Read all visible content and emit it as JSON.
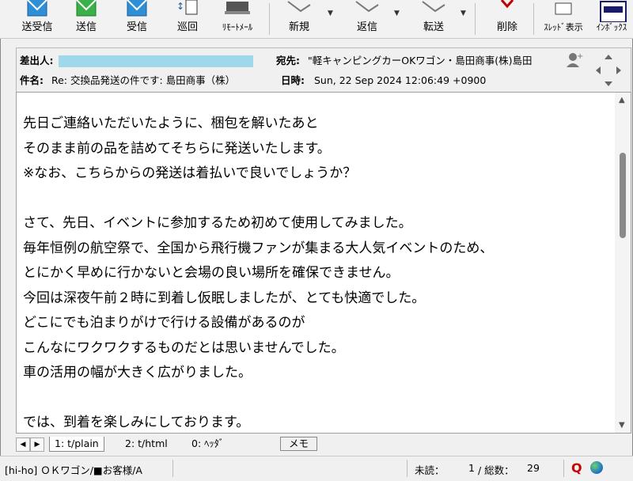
{
  "toolbar": {
    "buttons": [
      {
        "label": "送受信"
      },
      {
        "label": "送信"
      },
      {
        "label": "受信"
      },
      {
        "label": "巡回"
      },
      {
        "label": "ﾘﾓｰﾄﾒｰﾙ"
      },
      {
        "label": "新規"
      },
      {
        "label": "返信"
      },
      {
        "label": "転送"
      },
      {
        "label": "削除"
      },
      {
        "label": "ｽﾚｯﾄﾞ表示"
      },
      {
        "label": "ｲﾝﾎﾞｯｸｽ"
      }
    ]
  },
  "header": {
    "from_label": "差出人:",
    "from_value": "",
    "to_label": "宛先:",
    "to_value": "\"軽キャンピングカーOKワゴン・島田商事(株)島田",
    "subject_label": "件名:",
    "subject_value": "Re: 交換品発送の件です: 島田商事（株）",
    "date_label": "日時:",
    "date_value": "Sun, 22 Sep 2024 12:06:49 +0900"
  },
  "message": {
    "lines": [
      "先日ご連絡いただいたように、梱包を解いたあと",
      "そのまま前の品を詰めてそちらに発送いたします。",
      "※なお、こちらからの発送は着払いで良いでしょうか？",
      "",
      "さて、先日、イベントに参加するため初めて使用してみました。",
      "毎年恒例の航空祭で、全国から飛行機ファンが集まる大人気イベントのため、",
      "とにかく早めに行かないと会場の良い場所を確保できません。",
      "今回は深夜午前２時に到着し仮眠しましたが、とても快適でした。",
      "どこにでも泊まりがけで行ける設備があるのが",
      "こんなにワクワクするものだとは思いませんでした。",
      "車の活用の幅が大きく広がりました。",
      "",
      "では、到着を楽しみにしております。"
    ]
  },
  "tabs": {
    "items": [
      "1: t/plain",
      "2: t/html",
      "0: ﾍｯﾀﾞ"
    ],
    "memo": "メモ"
  },
  "status": {
    "folder": "[hi-ho] ＯＫワゴン/■お客様/A",
    "unread_label": "未読：",
    "unread_value": "1",
    "total_label": "/ 総数：",
    "total_value": "29"
  },
  "colors": {
    "sender_highlight": "#9fd8ea",
    "delete_icon": "#c00000"
  }
}
